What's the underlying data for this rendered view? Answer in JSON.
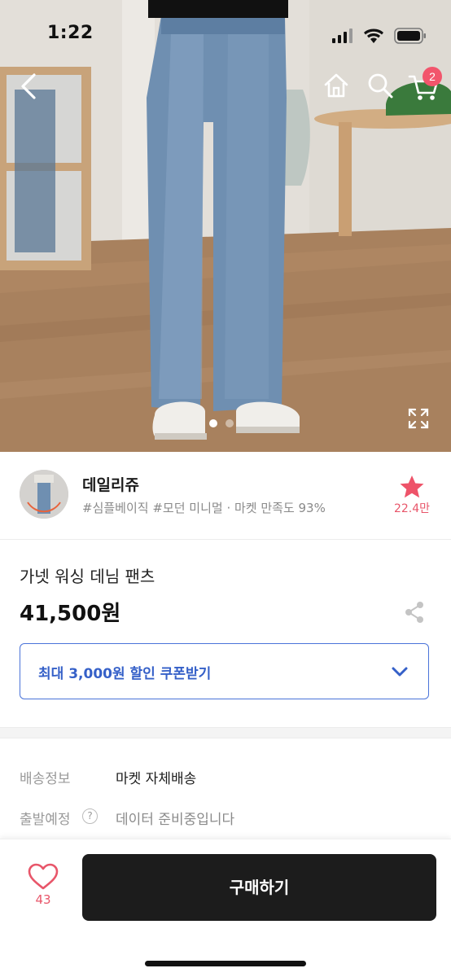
{
  "status_bar": {
    "time": "1:22"
  },
  "nav": {
    "cart_count": "2"
  },
  "gallery": {
    "slide_count": 2,
    "active_slide": 1
  },
  "seller": {
    "name": "데일리쥬",
    "tags": "#심플베이직 #모던 미니멀 · 마켓 만족도 93%",
    "favorite_count": "22.4만"
  },
  "product": {
    "title": "가넷 워싱 데님 팬츠",
    "price": "41,500원"
  },
  "coupon": {
    "label": "최대 3,000원 할인 쿠폰받기"
  },
  "shipping": {
    "info_label": "배송정보",
    "info_value": "마켓 자체배송",
    "departure_label": "출발예정",
    "help_mark": "?",
    "departure_value": "데이터 준비중입니다"
  },
  "bottom_bar": {
    "like_count": "43",
    "buy_label": "구매하기"
  },
  "colors": {
    "accent_pink": "#e8566a",
    "coupon_blue": "#3560c8",
    "buy_button": "#1c1c1c"
  }
}
